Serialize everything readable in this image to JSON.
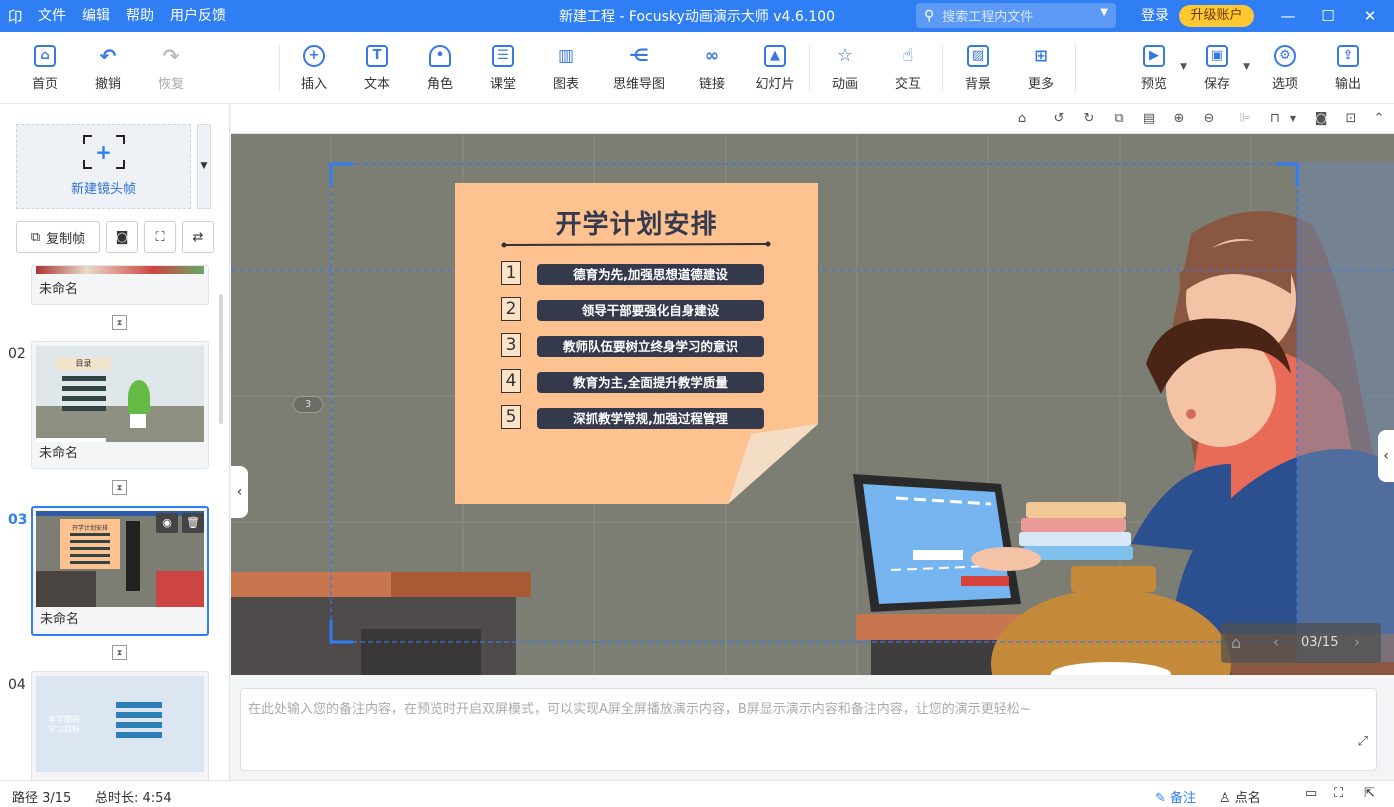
{
  "titlebar": {
    "logo": "卬",
    "menu": [
      "文件",
      "编辑",
      "帮助",
      "用户反馈"
    ],
    "title": "新建工程 - Focusky动画演示大师  v4.6.100",
    "search_placeholder": "搜索工程内文件",
    "login": "登录",
    "upgrade": "升级账户",
    "colors": {
      "bar": "#2f7ef4",
      "upgrade": "#ffc832"
    }
  },
  "toolbar": {
    "home": "首页",
    "undo": "撤销",
    "redo": "恢复",
    "insert": "插入",
    "text": "文本",
    "role": "角色",
    "class": "课堂",
    "chart": "图表",
    "mindmap": "思维导图",
    "link": "链接",
    "slideshow": "幻灯片",
    "animation": "动画",
    "interact": "交互",
    "background": "背景",
    "more": "更多",
    "preview": "预览",
    "save": "保存",
    "options": "选项",
    "export": "输出"
  },
  "leftpanel": {
    "new_frame": "新建镜头帧",
    "copy_frame": "复制帧",
    "slides": [
      {
        "num": "",
        "caption": "未命名"
      },
      {
        "num": "02",
        "caption": "未命名",
        "thumb_title": "目录"
      },
      {
        "num": "03",
        "caption": "未命名",
        "thumb_title": "开学计划安排"
      },
      {
        "num": "04",
        "caption": "",
        "thumb_lines": [
          "本学期的",
          "学习目标"
        ]
      }
    ]
  },
  "canvas": {
    "frame_badge": "3",
    "card_title": "开学计划安排",
    "items": [
      {
        "num": "1",
        "text": "德育为先,加强思想道德建设"
      },
      {
        "num": "2",
        "text": "领导干部要强化自身建设"
      },
      {
        "num": "3",
        "text": "教师队伍要树立终身学习的意识"
      },
      {
        "num": "4",
        "text": "教育为主,全面提升教学质量"
      },
      {
        "num": "5",
        "text": "深抓教学常规,加强过程管理"
      }
    ],
    "page_indicator": "03/15"
  },
  "notes": {
    "placeholder": "在此处输入您的备注内容，在预览时开启双屏模式，可以实现A屏全屏播放演示内容，B屏显示演示内容和备注内容，让您的演示更轻松~"
  },
  "statusbar": {
    "path": "路径 3/15",
    "duration": "总时长: 4:54",
    "notes": "备注",
    "rollcall": "点名"
  }
}
